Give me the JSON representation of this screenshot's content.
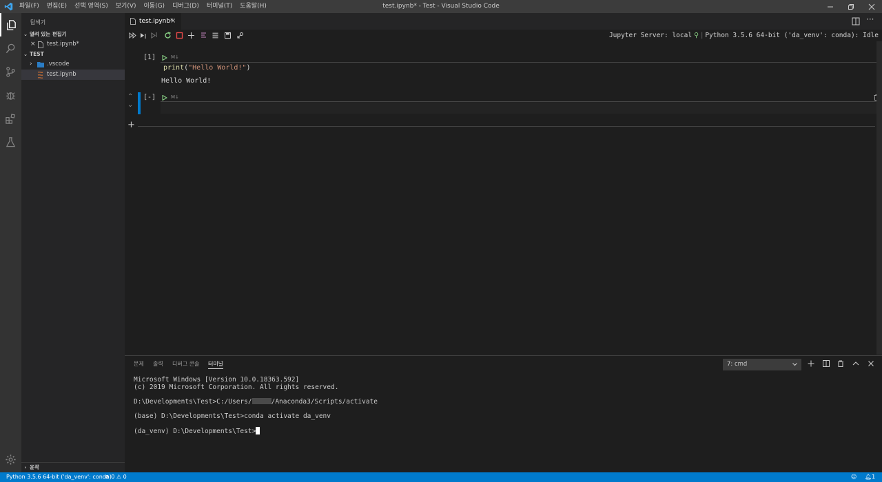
{
  "titlebar": {
    "menu": [
      "파일(F)",
      "편집(E)",
      "선택 영역(S)",
      "보기(V)",
      "이동(G)",
      "디버그(D)",
      "터미널(T)",
      "도움말(H)"
    ],
    "window_title": "test.ipynb* - Test - Visual Studio Code"
  },
  "sidebar": {
    "title": "탐색기",
    "open_editors_header": "열려 있는 편집기",
    "open_editors": [
      {
        "label": "test.ipynb*"
      }
    ],
    "folder_header": "TEST",
    "tree": [
      {
        "label": ".vscode"
      },
      {
        "label": "test.ipynb"
      }
    ],
    "outline_header": "윤곽"
  },
  "tabs": [
    {
      "label": "test.ipynb*"
    }
  ],
  "notebook": {
    "kernel_status": "Jupyter Server: local",
    "python_status": "Python 3.5.6 64-bit ('da_venv': conda): Idle",
    "cells": [
      {
        "counter": "[1]",
        "type_label": "M↓",
        "code": "print(\"Hello World!\")",
        "code_fn": "print",
        "code_open": "(",
        "code_str": "\"Hello World!\"",
        "code_close": ")",
        "output": "Hello World!"
      },
      {
        "counter": "[-]",
        "type_label": "M↓",
        "code": ""
      }
    ]
  },
  "panel": {
    "tabs": [
      "문제",
      "출력",
      "디버그 콘솔",
      "터미널"
    ],
    "active_tab": "터미널",
    "terminal_select": "7: cmd",
    "terminal_lines": [
      "Microsoft Windows [Version 10.0.18363.592]",
      "(c) 2019 Microsoft Corporation. All rights reserved.",
      "D:\\Developments\\Test>C:/Users/",
      "/Anaconda3/Scripts/activate",
      "(base) D:\\Developments\\Test>conda activate da_venv",
      "(da_venv) D:\\Developments\\Test>"
    ]
  },
  "statusbar": {
    "interpreter": "Python 3.5.6 64-bit ('da_venv': conda)",
    "errors": "0",
    "warnings": "0",
    "notifications": "1"
  },
  "colors": {
    "accent": "#007acc",
    "titlebar": "#3c3c3c",
    "activitybar": "#333333",
    "sidebar": "#252526",
    "editor": "#1e1e1e",
    "run_green": "#89d185",
    "stop_red": "#f14c4c",
    "string": "#ce9178",
    "function": "#dcdcaa"
  }
}
